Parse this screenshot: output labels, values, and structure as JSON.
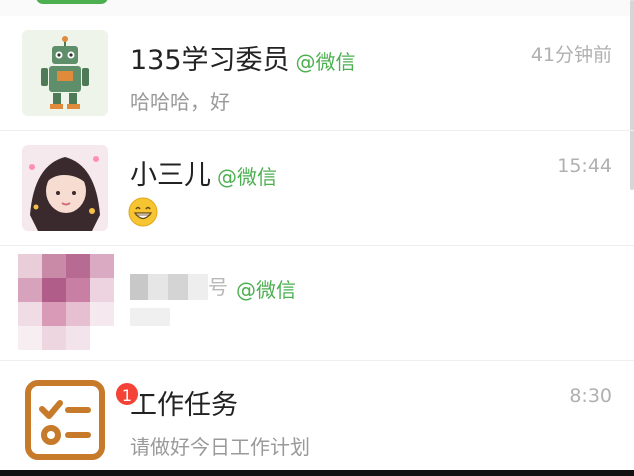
{
  "conversations": [
    {
      "name": "135学习委员",
      "source": "@微信",
      "preview": "哈哈哈，好",
      "time": "41分钟前",
      "avatar": "robot-avatar"
    },
    {
      "name": "小三儿",
      "source": "@微信",
      "preview_emoji": "grinning-emoji",
      "time": "15:44",
      "avatar": "girl-photo-avatar"
    },
    {
      "name_visible_fragment": "号",
      "source": "@微信",
      "time": "",
      "avatar": "pixelated-avatar"
    },
    {
      "name": "工作任务",
      "preview": "请做好今日工作计划",
      "time": "8:30",
      "badge_count": "1",
      "avatar": "task-list-icon"
    }
  ],
  "colors": {
    "source_green": "#4caf50",
    "badge_red": "#f44336",
    "task_orange": "#c77a2a"
  }
}
